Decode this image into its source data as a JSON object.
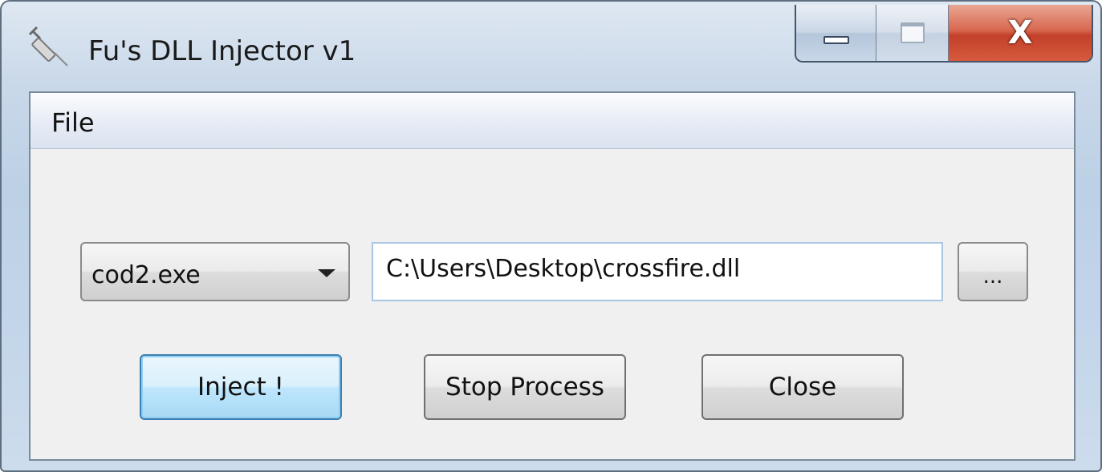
{
  "window": {
    "title": "Fu's DLL Injector v1",
    "caption_buttons": {
      "close_glyph": "X"
    },
    "accent_close": "#c3402a"
  },
  "menubar": {
    "items": [
      {
        "label": "File"
      }
    ]
  },
  "process": {
    "selected": "cod2.exe"
  },
  "dll": {
    "path": "C:\\Users\\Desktop\\crossfire.dll"
  },
  "browse": {
    "label": "..."
  },
  "buttons": {
    "inject": "Inject !",
    "stop": "Stop Process",
    "close": "Close"
  },
  "icons": {
    "app": "syringe-icon",
    "minimize": "minimize-icon",
    "maximize": "maximize-icon",
    "close": "close-icon",
    "dropdown": "chevron-down-icon"
  }
}
